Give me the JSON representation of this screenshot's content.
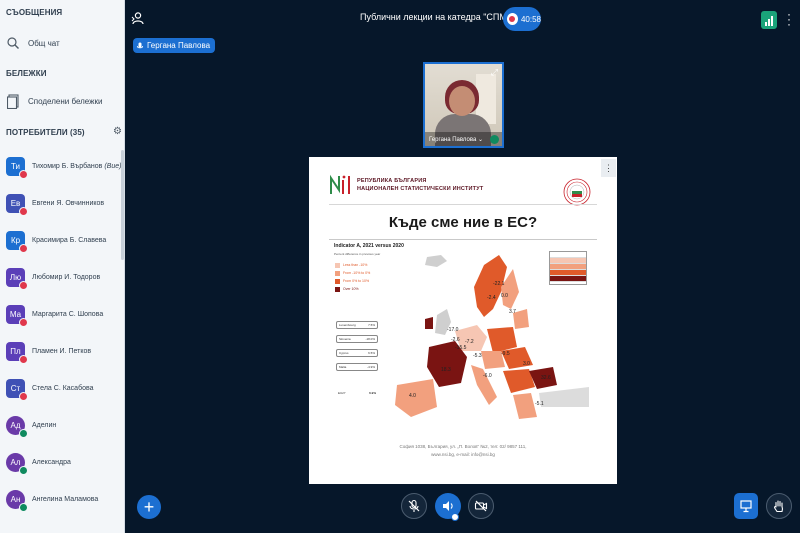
{
  "sidebar": {
    "messages_header": "СЪОБЩЕНИЯ",
    "public_chat_label": "Общ чат",
    "notes_header": "БЕЛЕЖКИ",
    "shared_notes_label": "Споделени бележки",
    "users_header": "ПОТРЕБИТЕЛИ (35)",
    "users": [
      {
        "initials": "Ти",
        "name": "Тихомир Б. Върбанов",
        "suffix": "(Вие)",
        "color": "#1c6fd1",
        "status": "muted"
      },
      {
        "initials": "Ев",
        "name": "Евгени Я. Овчинников",
        "suffix": "",
        "color": "#3f51b5",
        "status": "muted"
      },
      {
        "initials": "Кр",
        "name": "Красимира Б. Славева",
        "suffix": "",
        "color": "#1c6fd1",
        "status": "muted"
      },
      {
        "initials": "Лю",
        "name": "Любомир И. Тодоров",
        "suffix": "",
        "color": "#5b3fb8",
        "status": "muted"
      },
      {
        "initials": "Ма",
        "name": "Маргарита С. Шопова",
        "suffix": "",
        "color": "#5b3fb8",
        "status": "muted"
      },
      {
        "initials": "Пл",
        "name": "Пламен И. Петков",
        "suffix": "",
        "color": "#5b3fb8",
        "status": "muted"
      },
      {
        "initials": "Ст",
        "name": "Стела С. Касабова",
        "suffix": "",
        "color": "#3f51b5",
        "status": "muted"
      },
      {
        "initials": "Ад",
        "name": "Аделин",
        "suffix": "",
        "color": "#6a3aa8",
        "status": "listening"
      },
      {
        "initials": "Ал",
        "name": "Александра",
        "suffix": "",
        "color": "#6a3aa8",
        "status": "listening"
      },
      {
        "initials": "Ан",
        "name": "Ангелина Маламова",
        "suffix": "",
        "color": "#6a3aa8",
        "status": "listening"
      }
    ]
  },
  "topbar": {
    "title": "Публични лекции на катедра \"СПМ\"",
    "recording_time": "40:58"
  },
  "talker": {
    "name": "Гергана Павлова"
  },
  "webcam": {
    "name": "Гергана Павлова ⌄"
  },
  "slide": {
    "org_line1": "РЕПУБЛИКА БЪЛГАРИЯ",
    "org_line2": "НАЦИОНАЛЕН СТАТИСТИЧЕСКИ ИНСТИТУТ",
    "title": "Къде сме ние в ЕС?",
    "chart_title": "Indicator A, 2021 versus 2020",
    "chart_subtitle": "Percent difference in previous year",
    "legend": [
      {
        "label": "Less than -10%",
        "color": "#f6c6b3"
      },
      {
        "label": "From -10% to 0%",
        "color": "#f2a07e"
      },
      {
        "label": "From 0% to 10%",
        "color": "#e05a2a"
      },
      {
        "label": "Over 10%",
        "color": "#7a1412"
      }
    ],
    "insets": [
      {
        "name": "Luxembourg",
        "value": "7.5%"
      },
      {
        "name": "Slovenia",
        "value": "-18.0%"
      },
      {
        "name": "Cyprus",
        "value": "6.5%"
      },
      {
        "name": "Malta",
        "value": "-4.9%"
      }
    ],
    "total_label": "EU27",
    "total_value": "6.9%",
    "map_labels": [
      "-22.1",
      "-2.4",
      "0.0",
      "3.7",
      "-17.0",
      "-7.2",
      "-2.6",
      "-15.5",
      "-5.3",
      "-9.5",
      "3.0",
      "-6.0",
      "18.3",
      "32.6",
      "-5.1",
      "4.0"
    ],
    "footer_line1": "София 1038, България, ул. „П. Волов“ №2, тел: 02/ 9857 111,",
    "footer_line2": "www.nsi.bg, e-mail: info@nsi.bg"
  },
  "colors": {
    "accent": "#1c6fd1",
    "background": "#06172a",
    "muted_badge": "#e0384c",
    "listen_badge": "#0f8a5f"
  }
}
